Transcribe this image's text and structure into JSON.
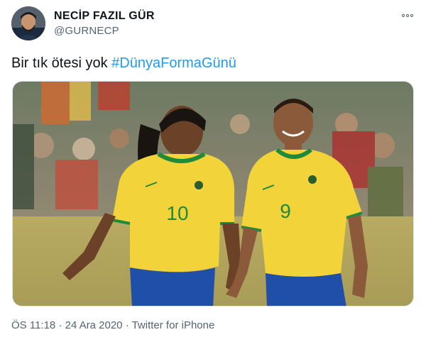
{
  "author": {
    "display_name": "NECİP FAZIL GÜR",
    "handle": "@GURNECP"
  },
  "tweet": {
    "text": "Bir tık ötesi yok",
    "hashtag": "#DünyaFormaGünü"
  },
  "media": {
    "players": [
      {
        "number": "10"
      },
      {
        "number": "9"
      }
    ]
  },
  "meta": {
    "time": "ÖS 11:18",
    "separator": "·",
    "date": "24 Ara 2020",
    "source": "Twitter for iPhone"
  },
  "colors": {
    "link": "#1d9bf0",
    "secondary_text": "#536471",
    "jersey_yellow": "#f3d33a",
    "jersey_green": "#1f8a3b",
    "shorts_blue": "#1f4fa8"
  }
}
